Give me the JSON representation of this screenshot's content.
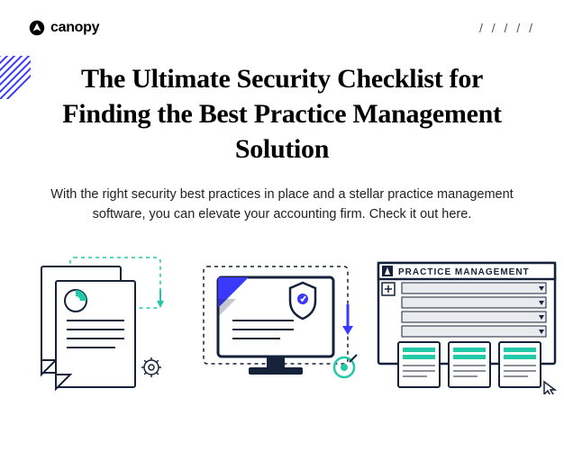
{
  "header": {
    "brand": "canopy",
    "slashes": "/ / / / /"
  },
  "title": "The Ultimate Security Checklist for Finding the Best Practice Management Solution",
  "subtitle": "With the right security best practices in place and a stellar practice management software, you can elevate your accounting firm. Check it out here.",
  "illustration_labels": {
    "panel_title": "PRACTICE MANAGEMENT"
  },
  "colors": {
    "accent_blue": "#3a3aff",
    "accent_teal": "#20c9a8",
    "ink": "#16223a"
  }
}
